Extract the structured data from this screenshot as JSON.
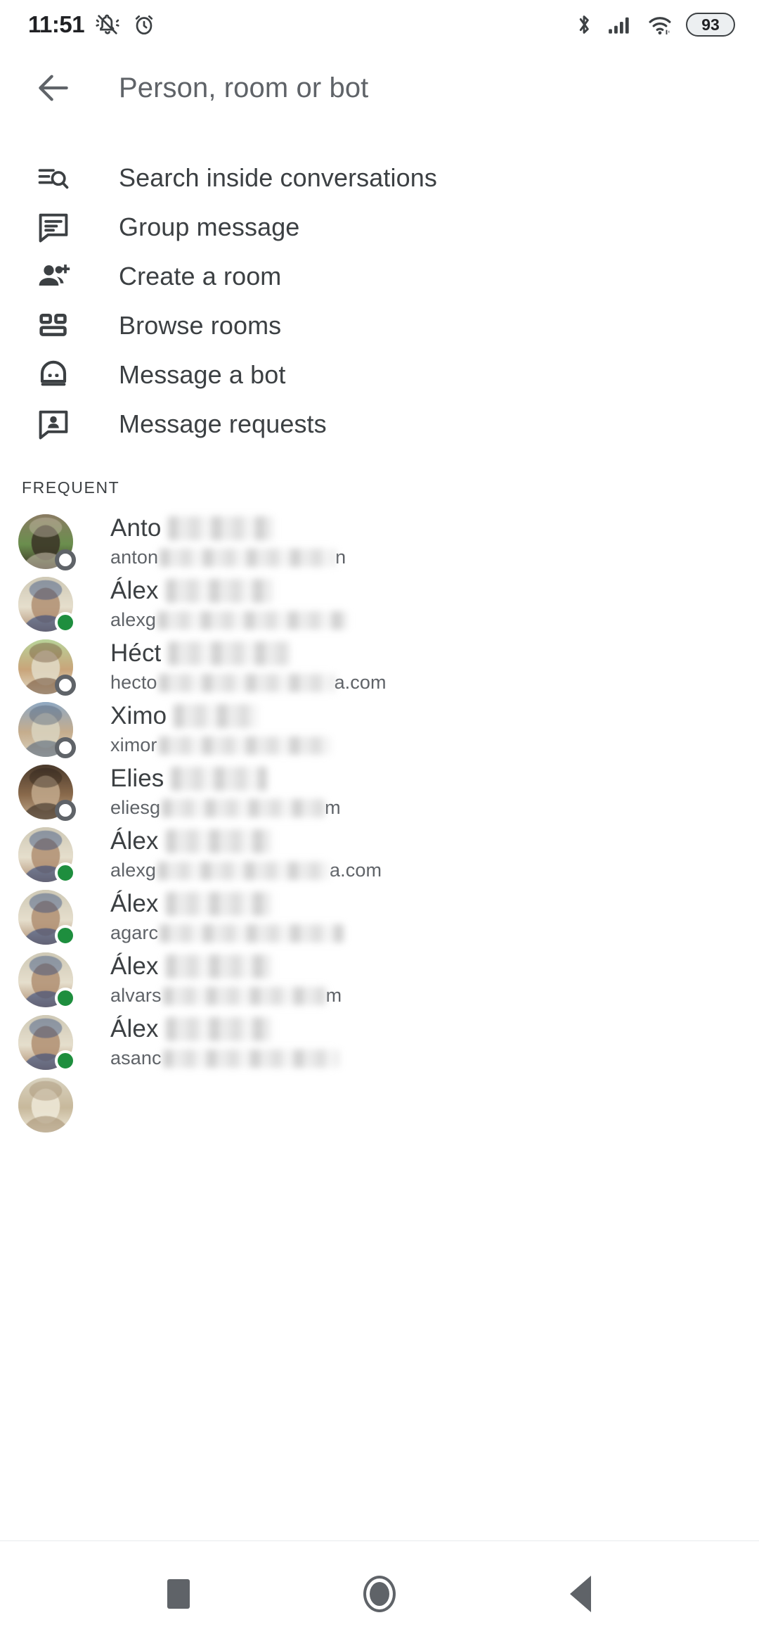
{
  "status_bar": {
    "time": "11:51",
    "battery_level": "93",
    "icons": [
      "mute-bell-icon",
      "alarm-icon",
      "bluetooth-icon",
      "cellular-signal-icon",
      "wifi-icon",
      "battery-icon"
    ]
  },
  "header": {
    "title": "Person, room or bot",
    "back_icon": "back-arrow-icon"
  },
  "actions": [
    {
      "label": "Search inside conversations",
      "icon": "search-list-icon"
    },
    {
      "label": "Group message",
      "icon": "chat-bubble-lines-icon"
    },
    {
      "label": "Create a room",
      "icon": "person-add-icon"
    },
    {
      "label": "Browse rooms",
      "icon": "rooms-grid-icon"
    },
    {
      "label": "Message a bot",
      "icon": "bot-icon"
    },
    {
      "label": "Message requests",
      "icon": "chat-bubble-person-icon"
    }
  ],
  "section": {
    "frequent_label": "FREQUENT"
  },
  "contacts": [
    {
      "name_prefix": "Anto",
      "name_blur_width": 150,
      "email_prefix": "anton",
      "email_suffix": "n",
      "email_blur_width": 250,
      "presence": "away",
      "avatar": "a1"
    },
    {
      "name_prefix": "Álex",
      "name_blur_width": 152,
      "email_prefix": "alexg",
      "email_suffix": "",
      "email_blur_width": 270,
      "presence": "online",
      "avatar": "a2"
    },
    {
      "name_prefix": "Héct",
      "name_blur_width": 175,
      "email_prefix": "hecto",
      "email_suffix": "a.com",
      "email_blur_width": 250,
      "presence": "away",
      "avatar": "a3"
    },
    {
      "name_prefix": "Ximo",
      "name_blur_width": 120,
      "email_prefix": "ximor",
      "email_suffix": "",
      "email_blur_width": 245,
      "presence": "away",
      "avatar": "a4"
    },
    {
      "name_prefix": "Elies",
      "name_blur_width": 137,
      "email_prefix": "eliesg",
      "email_suffix": "m",
      "email_blur_width": 232,
      "presence": "away",
      "avatar": "a5"
    },
    {
      "name_prefix": "Álex",
      "name_blur_width": 150,
      "email_prefix": "alexg",
      "email_suffix": "a.com",
      "email_blur_width": 245,
      "presence": "online",
      "avatar": "a2"
    },
    {
      "name_prefix": "Álex",
      "name_blur_width": 150,
      "email_prefix": "agarc",
      "email_suffix": "",
      "email_blur_width": 262,
      "presence": "online",
      "avatar": "a2"
    },
    {
      "name_prefix": "Álex",
      "name_blur_width": 150,
      "email_prefix": "alvars",
      "email_suffix": "m",
      "email_blur_width": 232,
      "presence": "online",
      "avatar": "a2"
    },
    {
      "name_prefix": "Álex",
      "name_blur_width": 150,
      "email_prefix": "asanc",
      "email_suffix": "",
      "email_blur_width": 250,
      "presence": "online",
      "avatar": "a2"
    },
    {
      "name_prefix": "",
      "name_blur_width": 0,
      "email_prefix": "",
      "email_suffix": "",
      "email_blur_width": 0,
      "presence": "none",
      "avatar": "a6"
    }
  ],
  "bottom_nav": {
    "recents_label": "recents-square-icon",
    "home_label": "home-circle-icon",
    "back_label": "back-triangle-icon"
  },
  "colors": {
    "online": "#1e8e3e",
    "away": "#5f6368",
    "text_primary": "#3c4043",
    "text_secondary": "#5f6368"
  }
}
